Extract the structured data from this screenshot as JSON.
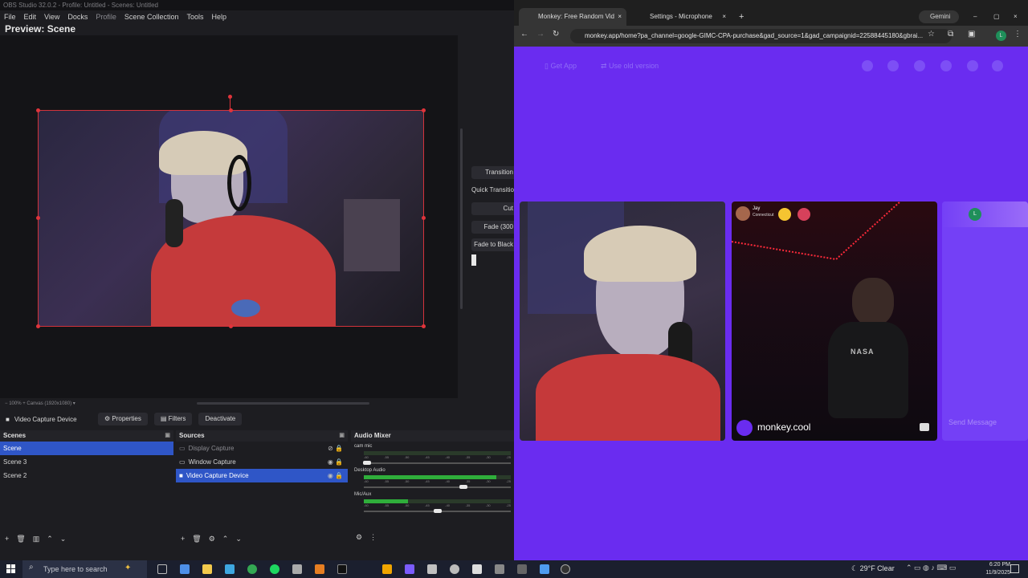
{
  "obs": {
    "window_title": "OBS Studio 32.0.2 - Profile: Untitled - Scenes: Untitled",
    "menu": [
      {
        "label": "File",
        "dim": false
      },
      {
        "label": "Edit",
        "dim": false
      },
      {
        "label": "View",
        "dim": false
      },
      {
        "label": "Docks",
        "dim": false
      },
      {
        "label": "Profile",
        "dim": true
      },
      {
        "label": "Scene Collection",
        "dim": false
      },
      {
        "label": "Tools",
        "dim": false
      },
      {
        "label": "Help",
        "dim": false
      }
    ],
    "preview_title": "Preview: Scene",
    "zoom_text": "100%",
    "canvas_text": "Canvas (1920x1080)",
    "transitions": {
      "transition_label": "Transition",
      "quick_label": "Quick Transition",
      "cut": "Cut",
      "fade": "Fade (300",
      "fade_black": "Fade to Black"
    },
    "context": {
      "source_name": "Video Capture Device",
      "properties": "Properties",
      "filters": "Filters",
      "deactivate": "Deactivate"
    },
    "scenes": {
      "title": "Scenes",
      "items": [
        {
          "label": "Scene",
          "selected": true
        },
        {
          "label": "Scene 3",
          "selected": false
        },
        {
          "label": "Scene 2",
          "selected": false
        }
      ]
    },
    "sources": {
      "title": "Sources",
      "items": [
        {
          "label": "Display Capture",
          "dim": true,
          "selected": false
        },
        {
          "label": "Window Capture",
          "dim": false,
          "selected": false
        },
        {
          "label": "Video Capture Device",
          "dim": false,
          "selected": true
        }
      ]
    },
    "mixer": {
      "title": "Audio Mixer",
      "channels": [
        {
          "label": "cam mic",
          "level": 0.0,
          "volume": 0.02
        },
        {
          "label": "Desktop Audio",
          "level": 0.9,
          "volume": 0.68
        },
        {
          "label": "Mic/Aux",
          "level": 0.3,
          "volume": 0.5
        }
      ],
      "ticks": [
        "-60",
        "-55",
        "-50",
        "-45",
        "-40",
        "-35",
        "-30",
        "-25"
      ]
    }
  },
  "browser": {
    "tabs": [
      {
        "label": "Monkey: Free Random Vid",
        "active": true
      },
      {
        "label": "Settings - Microphone",
        "active": false
      }
    ],
    "gemini": "Gemini",
    "url": "monkey.app/home?pa_channel=google-GIMC-CPA-purchase&gad_source=1&gad_campaignid=22588445180&gbrai...",
    "profile_letter": "L",
    "site": {
      "get_app": "Get App",
      "old_version": "Use old version",
      "partner_name": "Jay",
      "partner_location": "Connecticut",
      "watermark": "monkey.cool",
      "send_message": "Send Message",
      "chat_avatar": "L",
      "shirt_text": "NASA"
    }
  },
  "taskbar": {
    "search_placeholder": "Type here to search",
    "weather": "29°F  Clear",
    "time": "6:20 PM",
    "date": "11/9/2025"
  }
}
